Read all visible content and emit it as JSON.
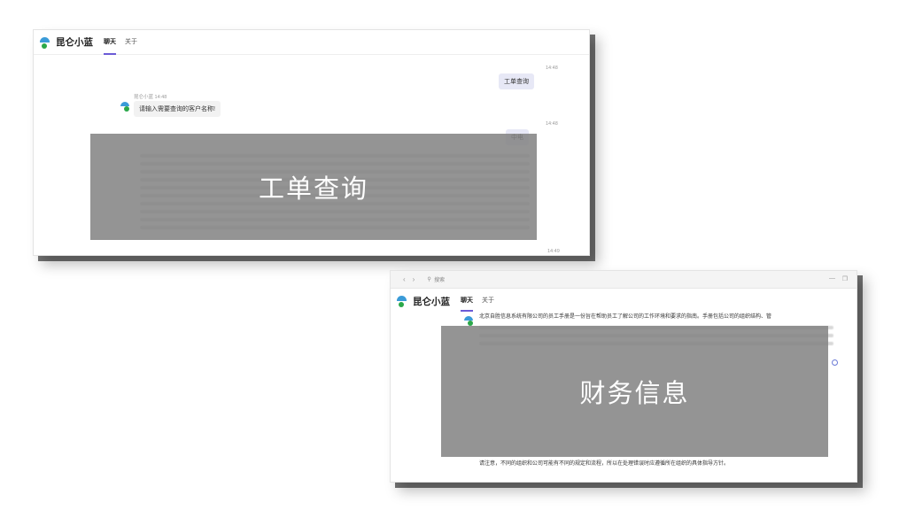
{
  "shot1": {
    "brand": "昆仑小蓝",
    "tabs": [
      {
        "label": "聊天"
      },
      {
        "label": "关于"
      }
    ],
    "messages": {
      "t1": "14:48",
      "user_msg1": "工单查询",
      "bot_meta": "昆仑小蓝  14:48",
      "bot_msg1": "请输入需要查询的客户名称!",
      "t2": "14:48",
      "user_msg2_partial": "中电",
      "t3": "14:49"
    },
    "overlay_label": "工单查询"
  },
  "shot2": {
    "search_placeholder": "搜索",
    "brand": "昆仑小蓝",
    "tabs": [
      {
        "label": "聊天"
      },
      {
        "label": "关于"
      }
    ],
    "intro_line1": "北京自胜信息系统有限公司的员工手册是一份旨在帮助员工了解公司的工作环境和要求的指南。手册包括公司的组织结构、管",
    "footer_note": "请注意，不同的组织和公司可能有不同的规定和流程，所以在处理错误时应遵循所在组织的具体指导方针。",
    "overlay_label": "财务信息"
  },
  "colors": {
    "accent": "#6b5bd6",
    "overlay": "#828282",
    "user_bubble": "#e7e8f6"
  },
  "icons": [
    "logo-icon",
    "avatar-icon",
    "back-icon",
    "forward-icon",
    "search-icon",
    "minimize-icon",
    "restore-icon",
    "settings-icon"
  ]
}
